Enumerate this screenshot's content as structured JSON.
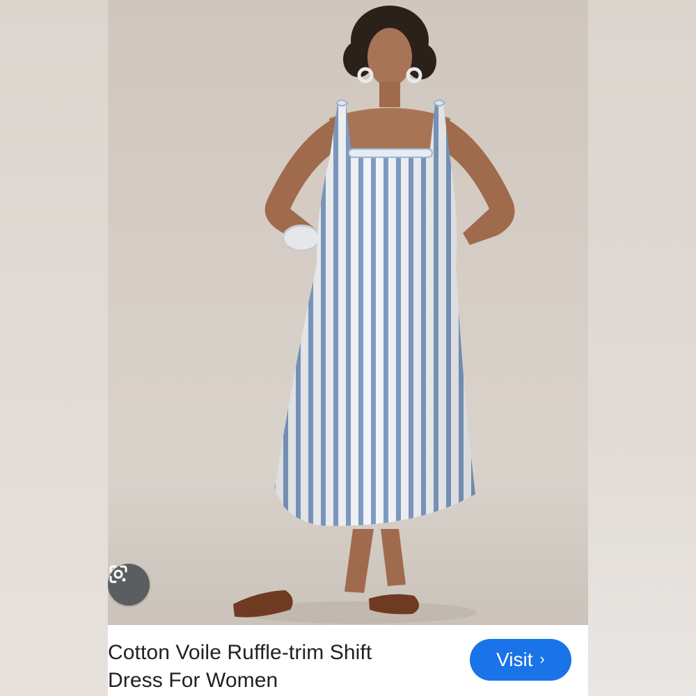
{
  "result_card": {
    "title_line_1": "Cotton Voile Ruffle-trim Shift",
    "title_line_2": "Dress For Women",
    "visit_label": "Visit",
    "visit_chevron": "›",
    "accent_color": "#1a73e8"
  },
  "icons": {
    "lens": "google-lens-icon",
    "chevron": "chevron-right-icon"
  },
  "image": {
    "subject": "product-photo"
  }
}
